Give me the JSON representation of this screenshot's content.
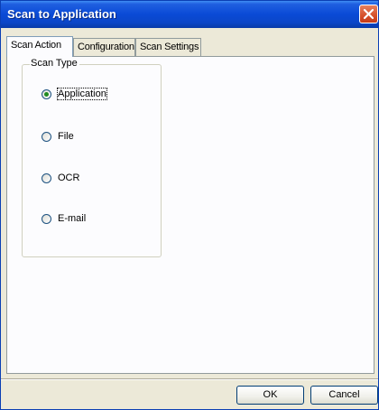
{
  "window": {
    "title": "Scan to Application",
    "close_icon": "close-icon",
    "title_bar_color": "#0a4ad6"
  },
  "tabs": [
    {
      "label": "Scan Action",
      "active": true
    },
    {
      "label": "Configuration",
      "active": false
    },
    {
      "label": "Scan Settings",
      "active": false
    }
  ],
  "scan_type": {
    "group_label": "Scan Type",
    "options": [
      {
        "label": "Application",
        "selected": true
      },
      {
        "label": "File",
        "selected": false
      },
      {
        "label": "OCR",
        "selected": false
      },
      {
        "label": "E-mail",
        "selected": false
      }
    ]
  },
  "buttons": {
    "ok_label": "OK",
    "cancel_label": "Cancel"
  }
}
